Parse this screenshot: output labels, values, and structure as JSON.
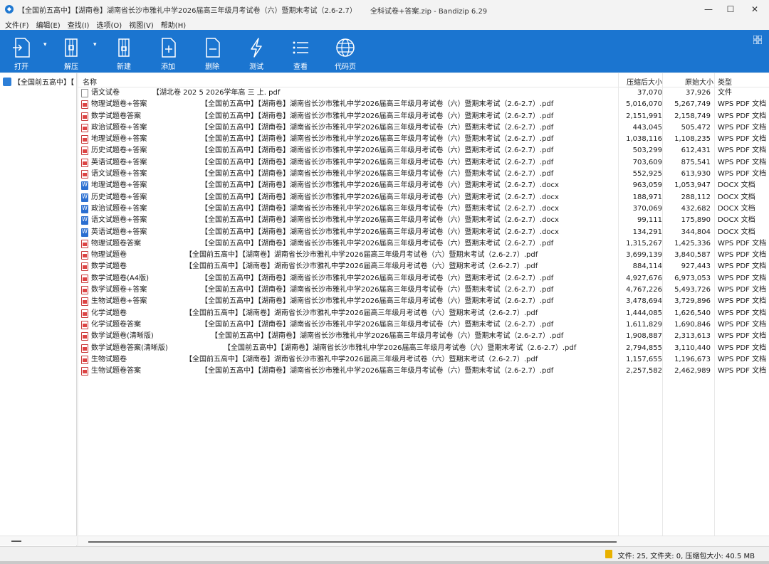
{
  "window": {
    "title_left": "【全国前五高中】【湖南卷】湖南省长沙市雅礼中学2026届高三年级月考试卷（六）暨期末考试（2.6-2.7）",
    "title_center": "全科试卷+答案.zip - Bandizip 6.29",
    "controls": [
      "—",
      "☐",
      "✕"
    ]
  },
  "menu": [
    "文件(F)",
    "编辑(E)",
    "查找(I)",
    "选项(O)",
    "视图(V)",
    "帮助(H)"
  ],
  "toolbar": {
    "open": "打开",
    "extract": "解压",
    "new": "新建",
    "add": "添加",
    "delete": "删除",
    "test": "测试",
    "view": "查看",
    "codepage": "代码页"
  },
  "sidebar": {
    "root": "【全国前五高中】【"
  },
  "columns": {
    "name": "名称",
    "compressed": "压缩后大小",
    "original": "原始大小",
    "type": "类型"
  },
  "files": [
    {
      "icon": "file",
      "name": "语文试卷",
      "ext": "【湖北卷   202 5   2026学年高  三  上. pdf",
      "compressed": "37,070",
      "original": "37,926",
      "type": "文件"
    },
    {
      "icon": "pdf",
      "name": "物理试题卷+答案",
      "ext": "【全国前五高中】【湖南卷】湖南省长沙市雅礼中学2026届高三年级月考试卷（六）暨期末考试（2.6-2.7）.pdf",
      "compressed": "5,016,070",
      "original": "5,267,749",
      "type": "WPS PDF 文档"
    },
    {
      "icon": "pdf",
      "name": "数学试题卷答案",
      "ext": "【全国前五高中】【湖南卷】湖南省长沙市雅礼中学2026届高三年级月考试卷（六）暨期末考试（2.6-2.7）.pdf",
      "compressed": "2,151,991",
      "original": "2,158,749",
      "type": "WPS PDF 文档"
    },
    {
      "icon": "pdf",
      "name": "政治试题卷+答案",
      "ext": "【全国前五高中】【湖南卷】湖南省长沙市雅礼中学2026届高三年级月考试卷（六）暨期末考试（2.6-2.7）.pdf",
      "compressed": "443,045",
      "original": "505,472",
      "type": "WPS PDF 文档"
    },
    {
      "icon": "pdf",
      "name": "地理试题卷+答案",
      "ext": "【全国前五高中】【湖南卷】湖南省长沙市雅礼中学2026届高三年级月考试卷（六）暨期末考试（2.6-2.7）.pdf",
      "compressed": "1,038,116",
      "original": "1,108,235",
      "type": "WPS PDF 文档"
    },
    {
      "icon": "pdf",
      "name": "历史试题卷+答案",
      "ext": "【全国前五高中】【湖南卷】湖南省长沙市雅礼中学2026届高三年级月考试卷（六）暨期末考试（2.6-2.7）.pdf",
      "compressed": "503,299",
      "original": "612,431",
      "type": "WPS PDF 文档"
    },
    {
      "icon": "pdf",
      "name": "英语试题卷+答案",
      "ext": "【全国前五高中】【湖南卷】湖南省长沙市雅礼中学2026届高三年级月考试卷（六）暨期末考试（2.6-2.7）.pdf",
      "compressed": "703,609",
      "original": "875,541",
      "type": "WPS PDF 文档"
    },
    {
      "icon": "pdf",
      "name": "语文试题卷+答案",
      "ext": "【全国前五高中】【湖南卷】湖南省长沙市雅礼中学2026届高三年级月考试卷（六）暨期末考试（2.6-2.7）.pdf",
      "compressed": "552,925",
      "original": "613,930",
      "type": "WPS PDF 文档"
    },
    {
      "icon": "docx",
      "name": "地理试题卷+答案",
      "ext": "【全国前五高中】【湖南卷】湖南省长沙市雅礼中学2026届高三年级月考试卷（六）暨期末考试（2.6-2.7）.docx",
      "compressed": "963,059",
      "original": "1,053,947",
      "type": "DOCX 文档"
    },
    {
      "icon": "docx",
      "name": "历史试题卷+答案",
      "ext": "【全国前五高中】【湖南卷】湖南省长沙市雅礼中学2026届高三年级月考试卷（六）暨期末考试（2.6-2.7）.docx",
      "compressed": "188,971",
      "original": "288,112",
      "type": "DOCX 文档"
    },
    {
      "icon": "docx",
      "name": "政治试题卷+答案",
      "ext": "【全国前五高中】【湖南卷】湖南省长沙市雅礼中学2026届高三年级月考试卷（六）暨期末考试（2.6-2.7）.docx",
      "compressed": "370,069",
      "original": "432,682",
      "type": "DOCX 文档"
    },
    {
      "icon": "docx",
      "name": "语文试题卷+答案",
      "ext": "【全国前五高中】【湖南卷】湖南省长沙市雅礼中学2026届高三年级月考试卷（六）暨期末考试（2.6-2.7）.docx",
      "compressed": "99,111",
      "original": "175,890",
      "type": "DOCX 文档"
    },
    {
      "icon": "docx",
      "name": "英语试题卷+答案",
      "ext": "【全国前五高中】【湖南卷】湖南省长沙市雅礼中学2026届高三年级月考试卷（六）暨期末考试（2.6-2.7）.docx",
      "compressed": "134,291",
      "original": "344,804",
      "type": "DOCX 文档"
    },
    {
      "icon": "pdf",
      "name": "物理试题卷答案",
      "ext": "【全国前五高中】【湖南卷】湖南省长沙市雅礼中学2026届高三年级月考试卷（六）暨期末考试（2.6-2.7）.pdf",
      "compressed": "1,315,267",
      "original": "1,425,336",
      "type": "WPS PDF 文档"
    },
    {
      "icon": "pdf",
      "name": "物理试题卷",
      "ext": "【全国前五高中】【湖南卷】湖南省长沙市雅礼中学2026届高三年级月考试卷（六）暨期末考试（2.6-2.7）.pdf",
      "compressed": "3,699,139",
      "original": "3,840,587",
      "type": "WPS PDF 文档"
    },
    {
      "icon": "pdf",
      "name": "数学试题卷",
      "ext": "【全国前五高中】【湖南卷】湖南省长沙市雅礼中学2026届高三年级月考试卷（六）暨期末考试（2.6-2.7）.pdf",
      "compressed": "884,114",
      "original": "927,443",
      "type": "WPS PDF 文档"
    },
    {
      "icon": "pdf",
      "name": "数学试题卷(A4版)",
      "ext": "【全国前五高中】【湖南卷】湖南省长沙市雅礼中学2026届高三年级月考试卷（六）暨期末考试（2.6-2.7）.pdf",
      "compressed": "4,927,676",
      "original": "6,973,053",
      "type": "WPS PDF 文档"
    },
    {
      "icon": "pdf",
      "name": "数学试题卷+答案",
      "ext": "【全国前五高中】【湖南卷】湖南省长沙市雅礼中学2026届高三年级月考试卷（六）暨期末考试（2.6-2.7）.pdf",
      "compressed": "4,767,226",
      "original": "5,493,726",
      "type": "WPS PDF 文档"
    },
    {
      "icon": "pdf",
      "name": "生物试题卷+答案",
      "ext": "【全国前五高中】【湖南卷】湖南省长沙市雅礼中学2026届高三年级月考试卷（六）暨期末考试（2.6-2.7）.pdf",
      "compressed": "3,478,694",
      "original": "3,729,896",
      "type": "WPS PDF 文档"
    },
    {
      "icon": "pdf",
      "name": "化学试题卷",
      "ext": "【全国前五高中】【湖南卷】湖南省长沙市雅礼中学2026届高三年级月考试卷（六）暨期末考试（2.6-2.7）.pdf",
      "compressed": "1,444,085",
      "original": "1,626,540",
      "type": "WPS PDF 文档"
    },
    {
      "icon": "pdf",
      "name": "化学试题卷答案",
      "ext": "【全国前五高中】【湖南卷】湖南省长沙市雅礼中学2026届高三年级月考试卷（六）暨期末考试（2.6-2.7）.pdf",
      "compressed": "1,611,829",
      "original": "1,690,846",
      "type": "WPS PDF 文档"
    },
    {
      "icon": "pdf",
      "name": "数学试题卷(清晰版)",
      "ext": "【全国前五高中】【湖南卷】湖南省长沙市雅礼中学2026届高三年级月考试卷（六）暨期末考试（2.6-2.7）.pdf",
      "compressed": "1,908,887",
      "original": "2,313,613",
      "type": "WPS PDF 文档"
    },
    {
      "icon": "pdf",
      "name": "数学试题卷答案(清晰版)",
      "ext": "【全国前五高中】【湖南卷】湖南省长沙市雅礼中学2026届高三年级月考试卷（六）暨期末考试（2.6-2.7）.pdf",
      "compressed": "2,794,855",
      "original": "3,110,440",
      "type": "WPS PDF 文档"
    },
    {
      "icon": "pdf",
      "name": "生物试题卷",
      "ext": "【全国前五高中】【湖南卷】湖南省长沙市雅礼中学2026届高三年级月考试卷（六）暨期末考试（2.6-2.7）.pdf",
      "compressed": "1,157,655",
      "original": "1,196,673",
      "type": "WPS PDF 文档"
    },
    {
      "icon": "pdf",
      "name": "生物试题卷答案",
      "ext": "【全国前五高中】【湖南卷】湖南省长沙市雅礼中学2026届高三年级月考试卷（六）暨期末考试（2.6-2.7）.pdf",
      "compressed": "2,257,582",
      "original": "2,462,989",
      "type": "WPS PDF 文档"
    }
  ],
  "status": "文件: 25, 文件夹: 0, 压缩包大小: 40.5 MB",
  "colors": {
    "toolbar": "#1b75d0",
    "pdf": "#d44444",
    "docx": "#2b6fd1"
  }
}
